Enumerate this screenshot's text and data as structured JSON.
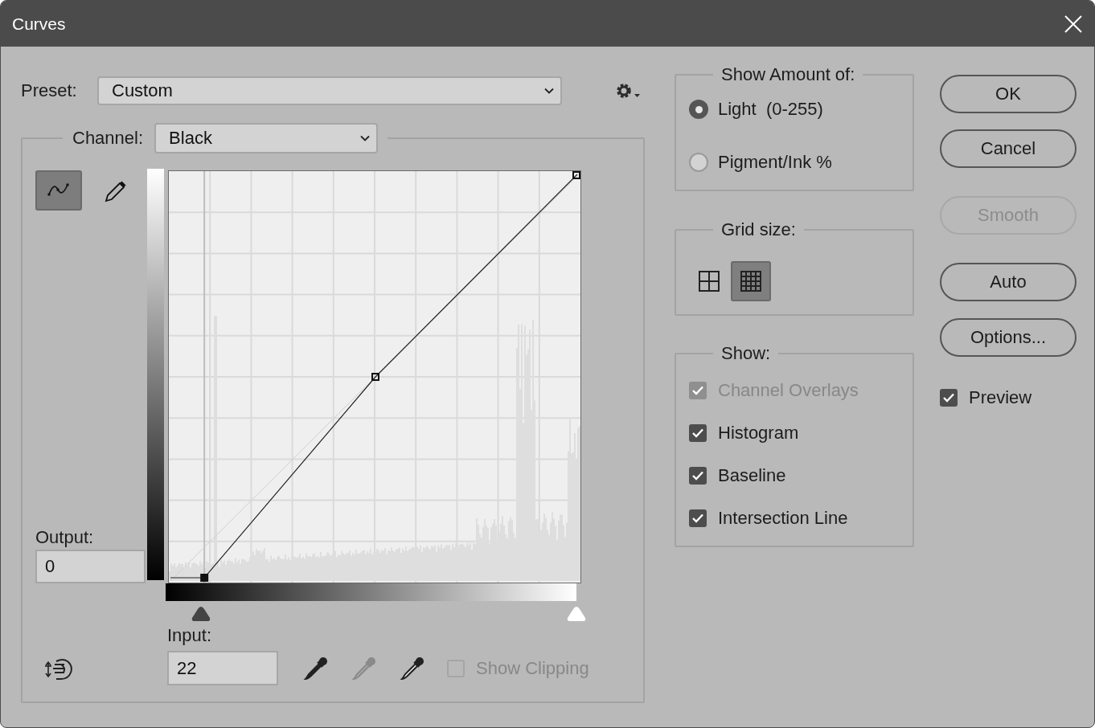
{
  "window": {
    "title": "Curves"
  },
  "preset": {
    "label": "Preset:",
    "value": "Custom"
  },
  "channel": {
    "label": "Channel:",
    "value": "Black"
  },
  "tools": [
    {
      "kind": "curve",
      "selected": true
    },
    {
      "kind": "pencil",
      "selected": false
    }
  ],
  "output": {
    "label": "Output:",
    "value": "0"
  },
  "input": {
    "label": "Input:",
    "value": "22"
  },
  "eyedroppers": [
    {
      "kind": "black"
    },
    {
      "kind": "gray"
    },
    {
      "kind": "white"
    }
  ],
  "show_clipping": {
    "label": "Show Clipping",
    "checked": false,
    "disabled": true
  },
  "show_amount": {
    "title": "Show Amount of:",
    "options": [
      {
        "label": "Light  (0-255)",
        "selected": true
      },
      {
        "label": "Pigment/Ink %",
        "selected": false
      }
    ]
  },
  "grid_size": {
    "title": "Grid size:",
    "options": [
      {
        "kind": "simple",
        "selected": false
      },
      {
        "kind": "detailed",
        "selected": true
      }
    ]
  },
  "show": {
    "title": "Show:",
    "options": [
      {
        "label": "Channel Overlays",
        "checked": true,
        "disabled": true
      },
      {
        "label": "Histogram",
        "checked": true,
        "disabled": false
      },
      {
        "label": "Baseline",
        "checked": true,
        "disabled": false
      },
      {
        "label": "Intersection Line",
        "checked": true,
        "disabled": false
      }
    ]
  },
  "buttons": [
    {
      "label": "OK",
      "disabled": false
    },
    {
      "label": "Cancel",
      "disabled": false
    },
    {
      "label": "Smooth",
      "disabled": true
    },
    {
      "label": "Auto",
      "disabled": false
    },
    {
      "label": "Options...",
      "disabled": false
    }
  ],
  "preview": {
    "label": "Preview",
    "checked": true
  }
}
